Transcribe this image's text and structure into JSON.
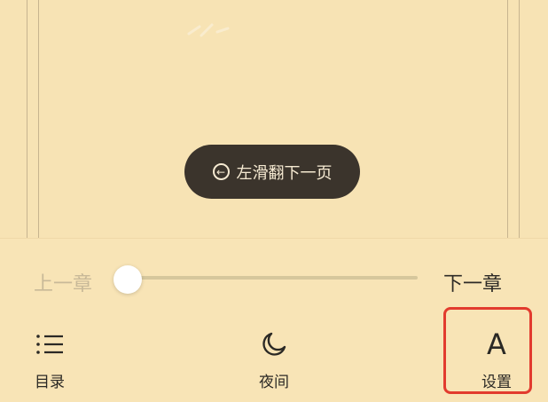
{
  "toast": {
    "icon": "circle-left-arrow-icon",
    "text": "左滑翻下一页"
  },
  "chapter_nav": {
    "prev_label": "上一章",
    "next_label": "下一章",
    "progress": 0.0
  },
  "bottom_nav": {
    "catalog": {
      "icon": "list-icon",
      "label": "目录"
    },
    "night": {
      "icon": "moon-icon",
      "label": "夜间"
    },
    "settings": {
      "icon": "font-a-icon",
      "glyph": "A",
      "label": "设置"
    }
  },
  "colors": {
    "background": "#f7e3b4",
    "toast_bg": "#3b342c",
    "highlight": "#e23b2e",
    "slider_track": "#d6c79c"
  }
}
